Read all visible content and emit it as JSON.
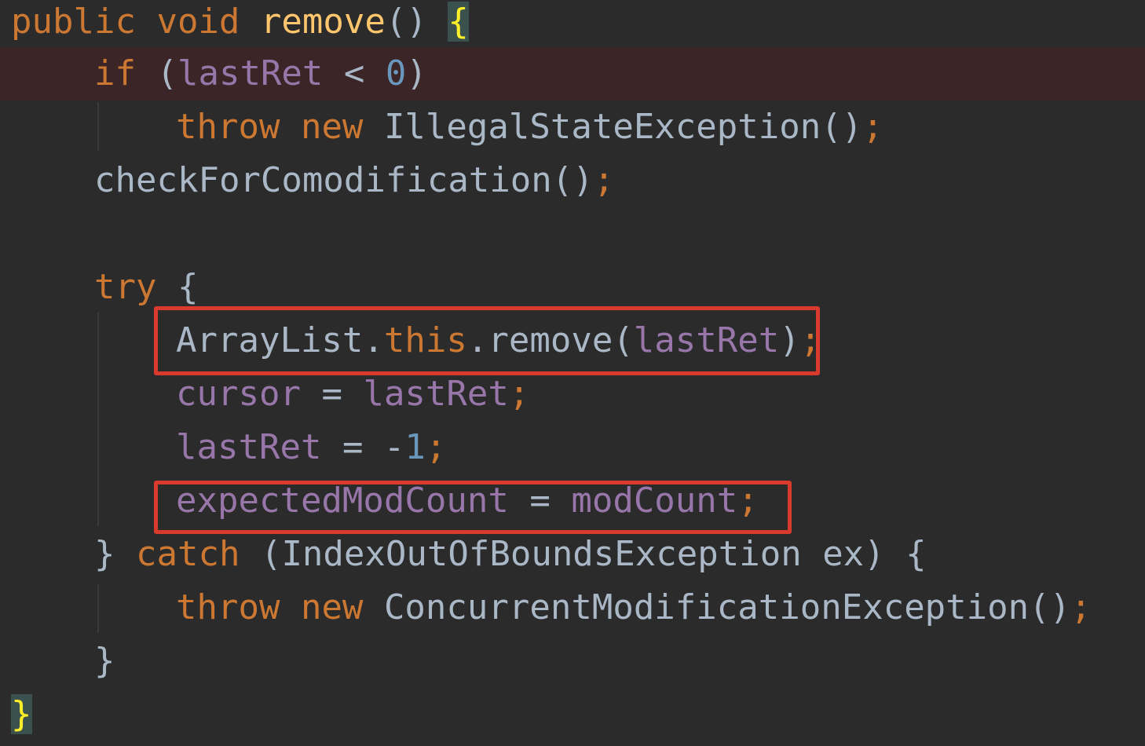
{
  "code": {
    "l1": {
      "public": "public",
      "void": "void",
      "name": "remove",
      "parens": "()",
      "brace": "{"
    },
    "l2": {
      "if": "if",
      "open": "(",
      "var": "lastRet",
      "op": "<",
      "num": "0",
      "close": ")"
    },
    "l3": {
      "throw": "throw",
      "new": "new",
      "call": "IllegalStateException()",
      "semi": ";"
    },
    "l4": {
      "call": "checkForComodification()",
      "semi": ";"
    },
    "l6": {
      "try": "try",
      "brace": "{"
    },
    "l7": {
      "cls": "ArrayList.",
      "this": "this",
      "method": ".remove(",
      "arg": "lastRet",
      "close": ")",
      "semi": ";"
    },
    "l8": {
      "lhs": "cursor",
      "op": "=",
      "rhs": "lastRet",
      "semi": ";"
    },
    "l9": {
      "lhs": "lastRet",
      "op": "= -",
      "num": "1",
      "semi": ";"
    },
    "l10": {
      "lhs": "expectedModCount",
      "op": "=",
      "rhs": "modCount",
      "semi": ";"
    },
    "l11": {
      "close": "}",
      "catch": "catch",
      "params": "(IndexOutOfBoundsException ex) {"
    },
    "l12": {
      "throw": "throw",
      "new": "new",
      "call": "ConcurrentModificationException()",
      "semi": ";"
    },
    "l13": {
      "close": "}"
    },
    "l14": {
      "close": "}"
    }
  },
  "colors": {
    "background": "#2b2b2b",
    "keyword": "#cc7832",
    "method_declaration": "#ffc66d",
    "field": "#9876aa",
    "number": "#6897bb",
    "plain": "#a9b7c6",
    "highlighted_line": "#3b2527",
    "matched_brace": "#ffef28",
    "annotation_box": "#d93a2b"
  }
}
